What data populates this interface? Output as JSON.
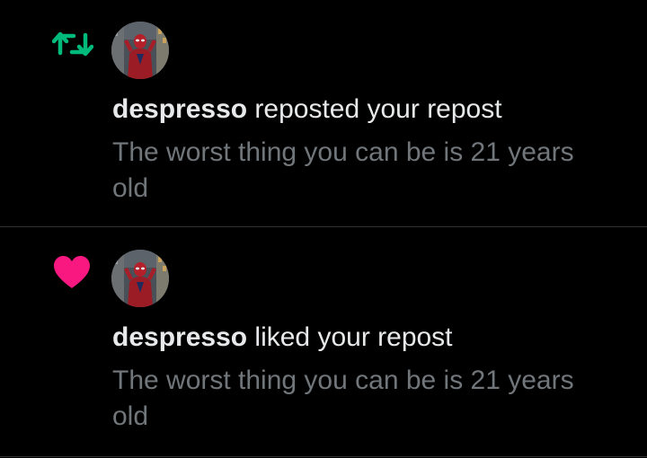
{
  "notifications": [
    {
      "type": "repost",
      "icon": "repost-icon",
      "icon_color": "#00ba7c",
      "username": "despresso",
      "action": " reposted your repost",
      "post_text": "The worst thing you can be is 21 years old"
    },
    {
      "type": "like",
      "icon": "heart-icon",
      "icon_color": "#f91880",
      "username": "despresso",
      "action": " liked your repost",
      "post_text": "The worst thing you can be is 21 years old"
    }
  ],
  "colors": {
    "background": "#000000",
    "primary_text": "#e7e9ea",
    "secondary_text": "#71767b",
    "divider": "#2f3336"
  }
}
